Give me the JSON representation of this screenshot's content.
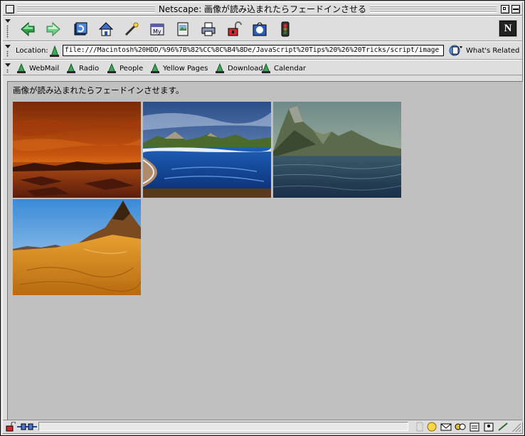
{
  "window": {
    "title": "Netscape: 画像が読み込まれたらフェードインさせる"
  },
  "navigation_toolbar": {
    "buttons": [
      {
        "name": "back-button",
        "icon": "back-arrow-icon"
      },
      {
        "name": "forward-button",
        "icon": "forward-arrow-icon"
      },
      {
        "name": "reload-button",
        "icon": "reload-icon"
      },
      {
        "name": "home-button",
        "icon": "home-icon"
      },
      {
        "name": "search-button",
        "icon": "search-wand-icon"
      },
      {
        "name": "my-netscape-button",
        "icon": "my-netscape-icon"
      },
      {
        "name": "images-button",
        "icon": "images-icon"
      },
      {
        "name": "print-button",
        "icon": "print-icon"
      },
      {
        "name": "security-button",
        "icon": "unlocked-padlock-icon"
      },
      {
        "name": "shop-button",
        "icon": "shop-icon"
      },
      {
        "name": "stop-button",
        "icon": "traffic-light-icon"
      }
    ],
    "logo": "N"
  },
  "location_bar": {
    "label": "Location:",
    "url": "file:///Macintosh%20HDD/%96%7B%82%CC%8C%B4%8De/JavaScript%20Tips%20%26%20Tricks/script/image",
    "whats_related": "What's Related"
  },
  "personal_toolbar": {
    "items": [
      {
        "label": "WebMail"
      },
      {
        "label": "Radio"
      },
      {
        "label": "People"
      },
      {
        "label": "Yellow Pages"
      },
      {
        "label": "Download"
      },
      {
        "label": "Calendar"
      }
    ]
  },
  "page": {
    "text": "画像が読み込まれたらフェードインさせます。",
    "images": [
      {
        "name": "sunset-lake-image"
      },
      {
        "name": "island-bay-image"
      },
      {
        "name": "mountain-sea-image"
      },
      {
        "name": "desert-peak-image"
      }
    ]
  },
  "colors": {
    "content_background": "#c0c0c0",
    "chrome": "#dedede"
  }
}
